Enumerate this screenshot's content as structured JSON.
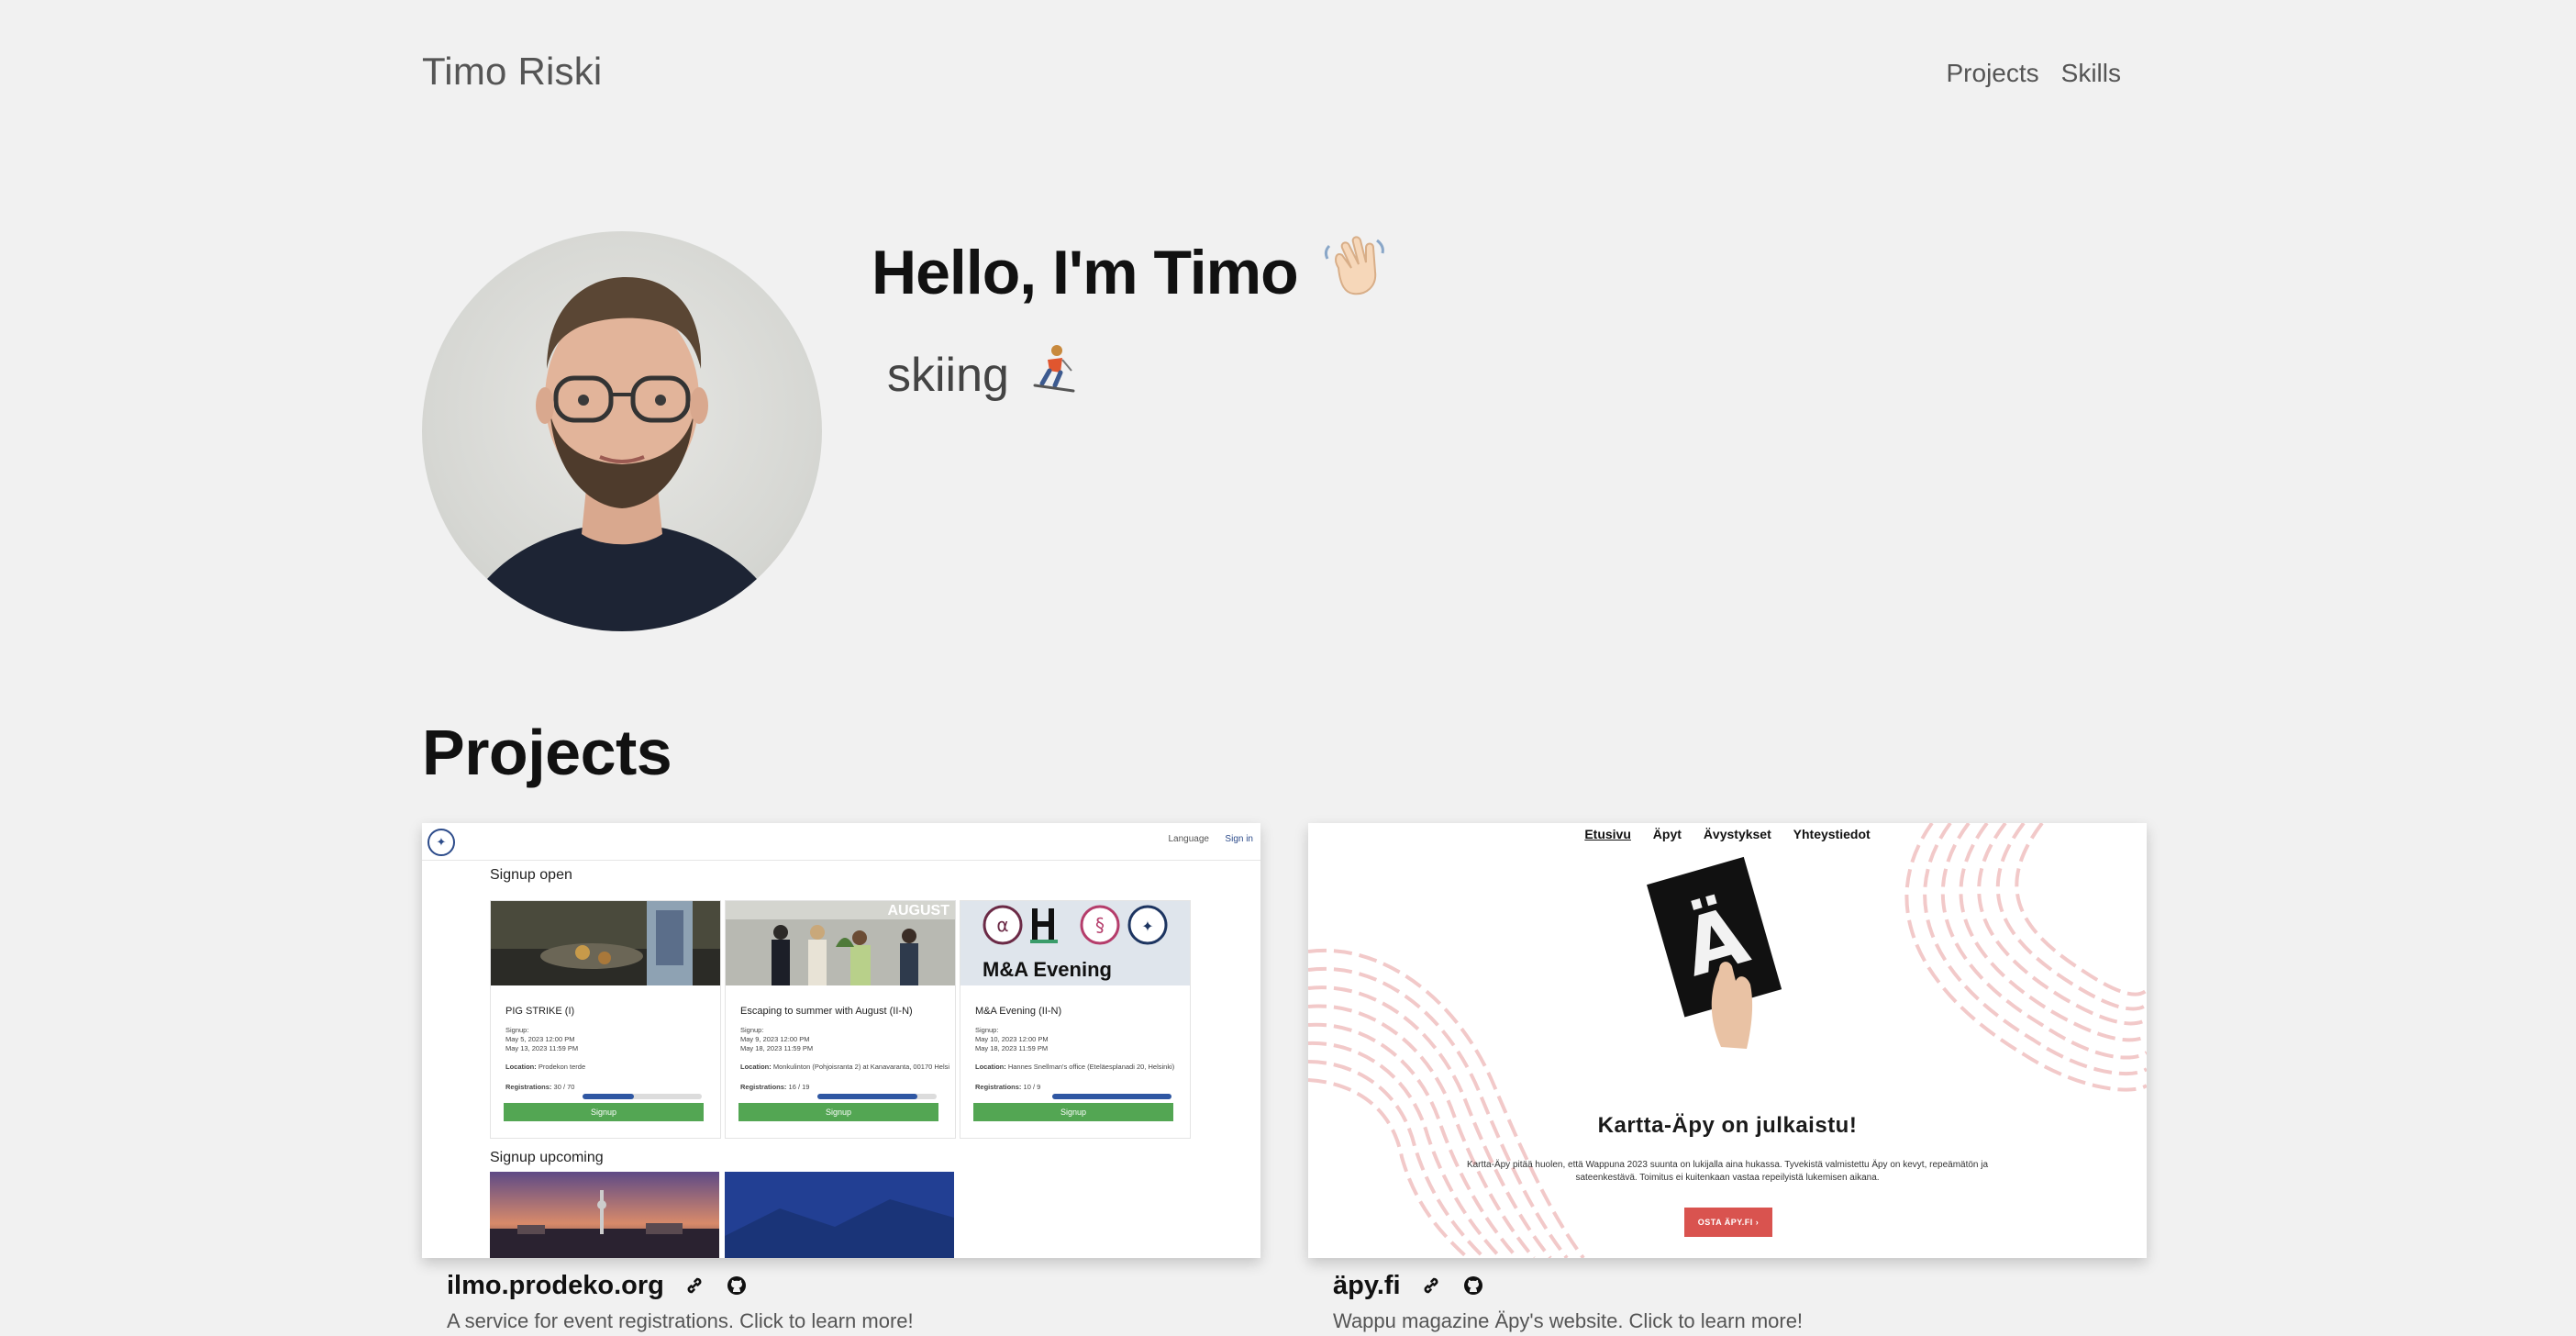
{
  "nav": {
    "brand": "Timo Riski",
    "links": [
      "Projects",
      "Skills"
    ]
  },
  "hero": {
    "title": "Hello, I'm Timo",
    "title_emoji": "👋🏻",
    "subtitle": "skiing",
    "subtitle_emoji": "⛷️"
  },
  "projects": {
    "title": "Projects",
    "items": [
      {
        "name": "ilmo.prodeko.org",
        "description": "A service for event registrations. Click to learn more!",
        "preview": {
          "language_label": "Language",
          "signin_label": "Sign in",
          "section_open": "Signup open",
          "section_upcoming": "Signup upcoming",
          "events": [
            {
              "name": "PIG STRIKE (I)",
              "signup_label": "Signup:",
              "start": "May 5, 2023 12:00 PM",
              "end": "May 13, 2023 11:59 PM",
              "location_label": "Location:",
              "location": "Prodekon terde",
              "registrations_label": "Registrations:",
              "registrations": "30 / 70",
              "fill": 0.43,
              "button": "Signup"
            },
            {
              "name": "Escaping to summer with August (II-N)",
              "signup_label": "Signup:",
              "start": "May 9, 2023 12:00 PM",
              "end": "May 18, 2023 11:59 PM",
              "location_label": "Location:",
              "location": "Monkulinton (Pohjoisranta 2) at Kanavaranta, 00170 Helsi",
              "registrations_label": "Registrations:",
              "registrations": "16 / 19",
              "fill": 0.84,
              "button": "Signup",
              "image_caption": "AUGUST"
            },
            {
              "name": "M&A Evening (II-N)",
              "signup_label": "Signup:",
              "start": "May 10, 2023 12:00 PM",
              "end": "May 18, 2023 11:59 PM",
              "location_label": "Location:",
              "location": "Hannes Snellman's office (Eteläesplanadi 20, Helsinki)",
              "registrations_label": "Registrations:",
              "registrations": "10 / 9",
              "fill": 1.0,
              "button": "Signup",
              "image_caption": "M&A Evening"
            }
          ]
        }
      },
      {
        "name": "äpy.fi",
        "description": "Wappu magazine Äpy's website. Click to learn more!",
        "preview": {
          "nav": [
            "Etusivu",
            "Äpyt",
            "Ävystykset",
            "Yhteystiedot"
          ],
          "heading": "Kartta-Äpy on julkaistu!",
          "text": "Kartta-Äpy pitää huolen, että Wappuna 2023 suunta on lukijalla aina hukassa. Tyvekistä valmistettu Äpy on kevyt, repeämätön ja sateenkestävä. Toimitus ei kuitenkaan vastaa repeilyistä lukemisen aikana.",
          "button": "OSTA ÄPY.FI ›",
          "cover_letter": "Ä"
        }
      }
    ]
  },
  "colors": {
    "background": "#f1f1f1",
    "signup_green": "#53a653",
    "apy_red": "#d9534f"
  }
}
